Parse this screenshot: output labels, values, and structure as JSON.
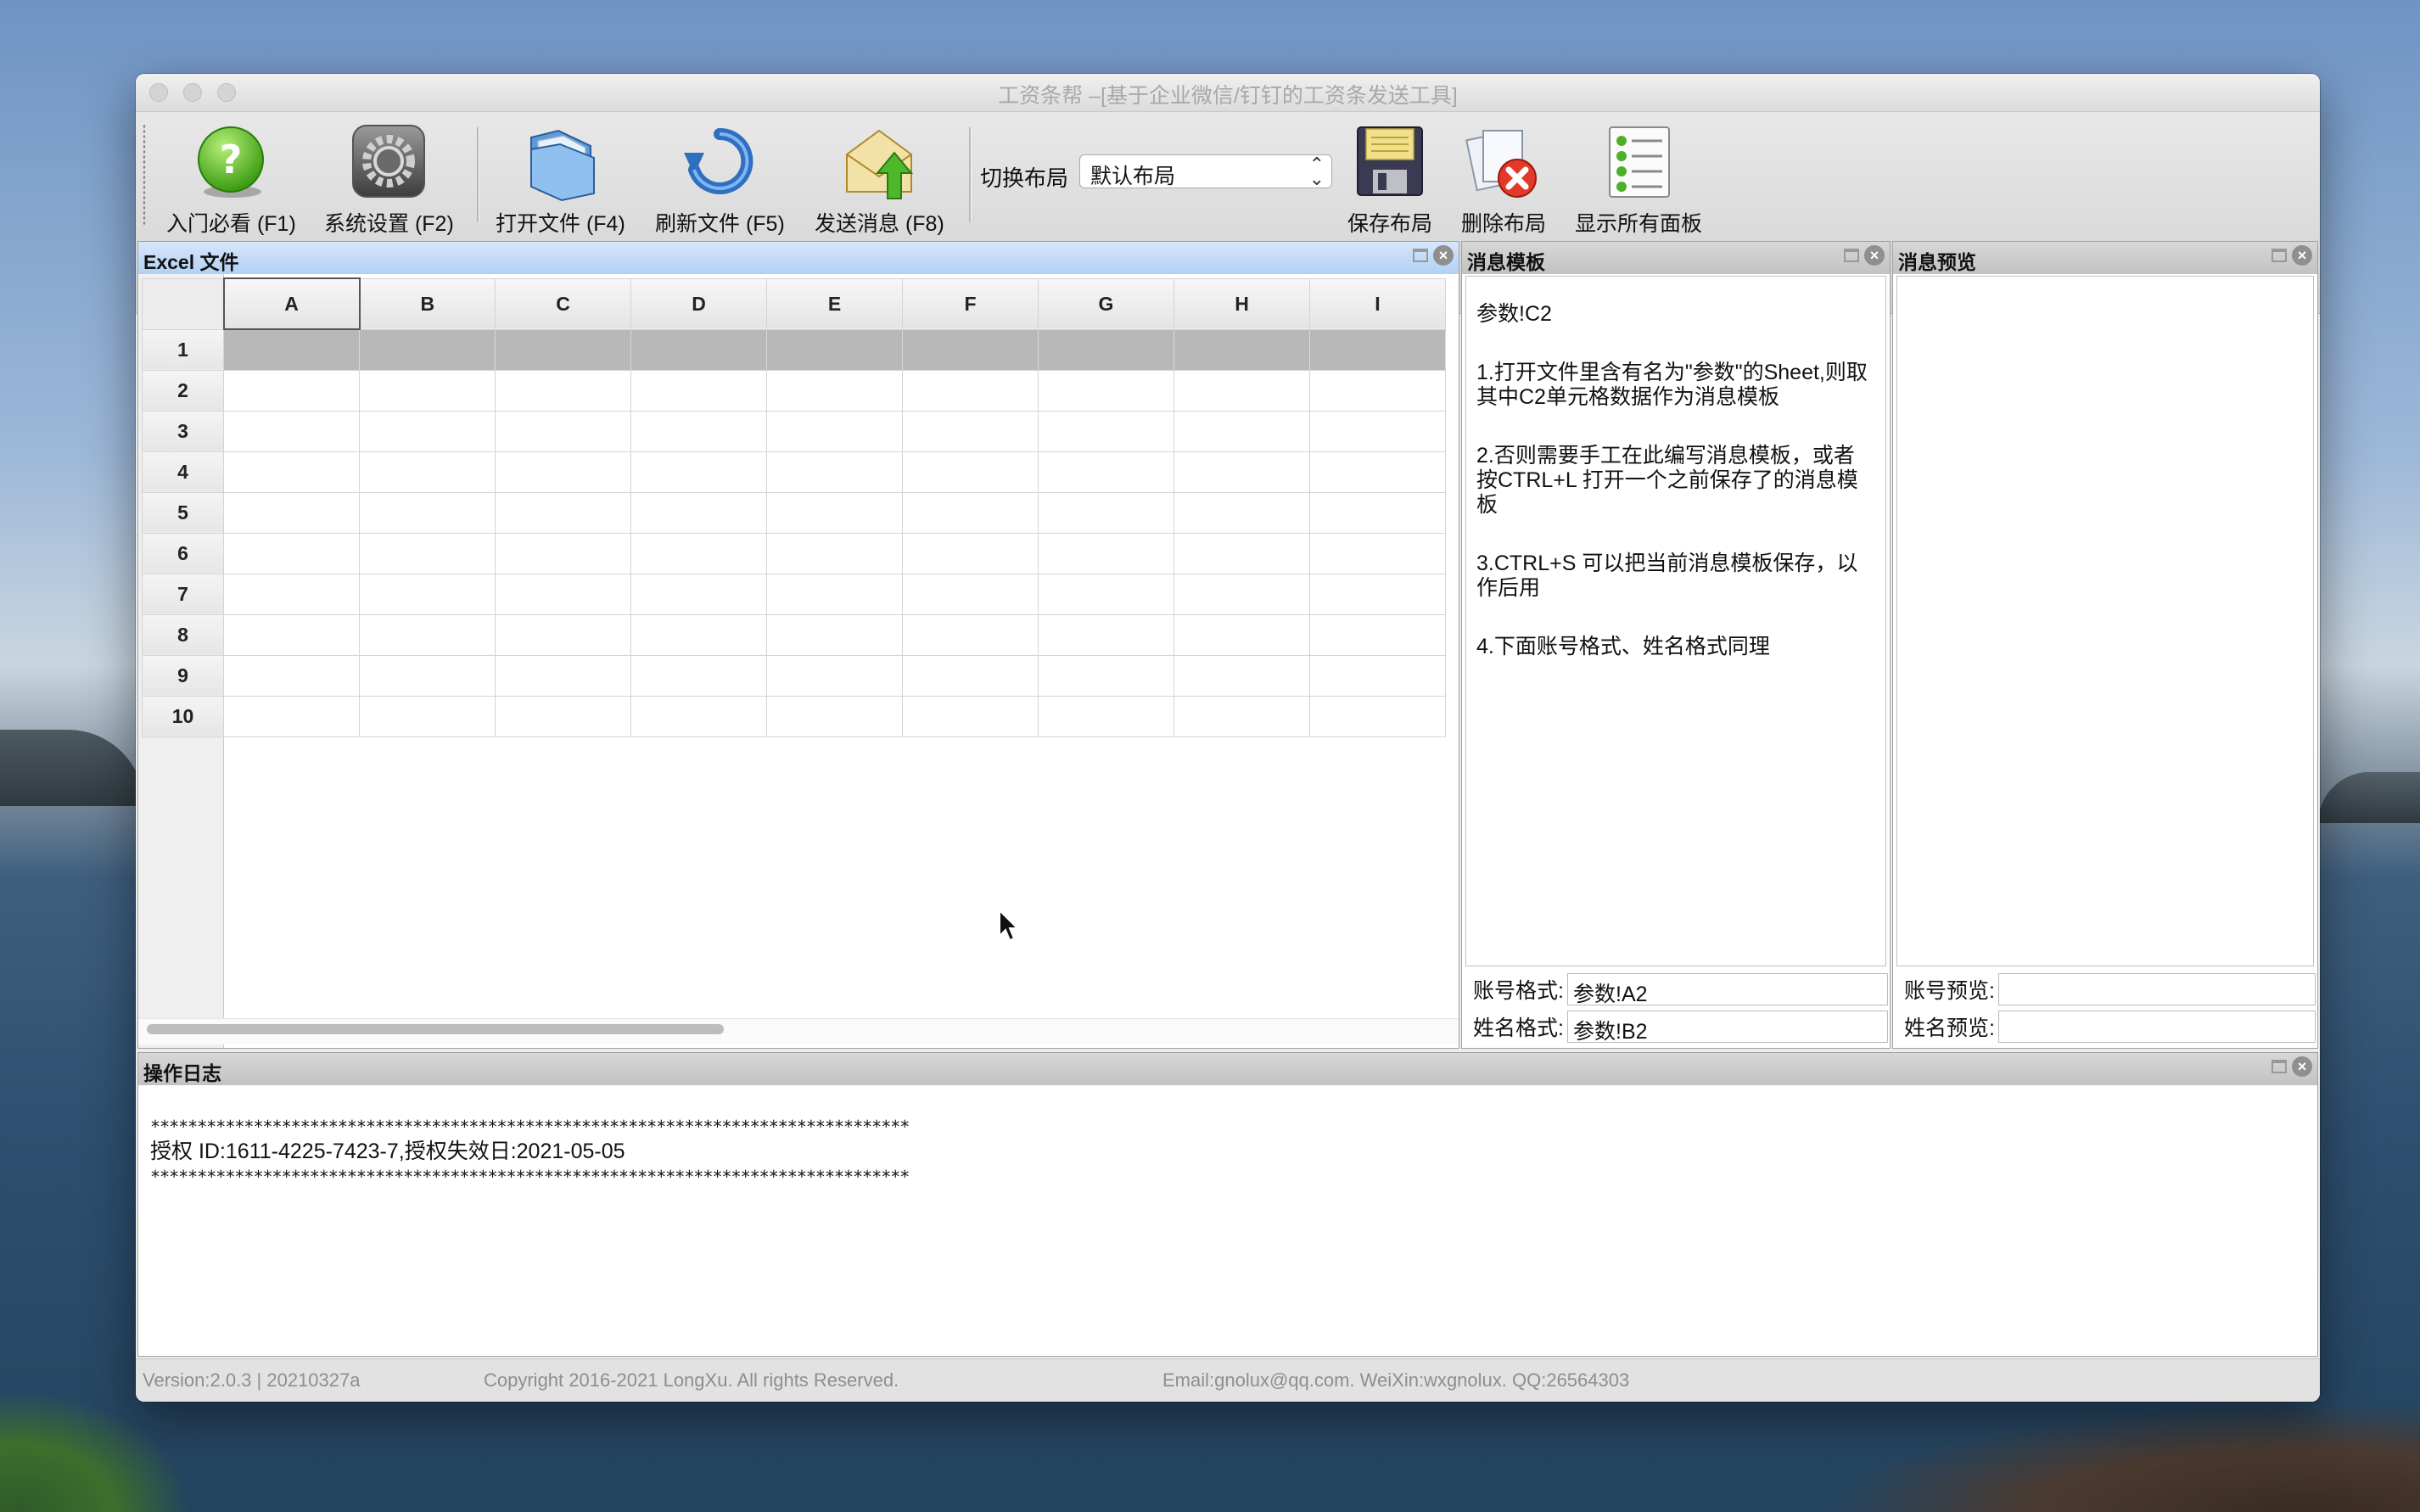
{
  "window": {
    "title": "工资条帮 –[基于企业微信/钉钉的工资条发送工具]"
  },
  "toolbar": {
    "help": "入门必看 (F1)",
    "settings": "系统设置 (F2)",
    "open_file": "打开文件 (F4)",
    "refresh_file": "刷新文件 (F5)",
    "send_message": "发送消息 (F8)",
    "switch_layout_label": "切换布局",
    "layout_value": "默认布局",
    "save_layout": "保存布局",
    "delete_layout": "删除布局",
    "show_all_panels": "显示所有面板"
  },
  "excel_panel": {
    "title": "Excel 文件",
    "columns": [
      "A",
      "B",
      "C",
      "D",
      "E",
      "F",
      "G",
      "H",
      "I"
    ],
    "rows": [
      "1",
      "2",
      "3",
      "4",
      "5",
      "6",
      "7",
      "8",
      "9",
      "10"
    ]
  },
  "template_panel": {
    "title": "消息模板",
    "lines": [
      "参数!C2",
      "1.打开文件里含有名为\"参数\"的Sheet,则取其中C2单元格数据作为消息模板",
      "2.否则需要手工在此编写消息模板，或者按CTRL+L 打开一个之前保存了的消息模板",
      "3.CTRL+S 可以把当前消息模板保存，以作后用",
      "4.下面账号格式、姓名格式同理"
    ],
    "account_format_label": "账号格式:",
    "account_format_value": "参数!A2",
    "name_format_label": "姓名格式:",
    "name_format_value": "参数!B2"
  },
  "preview_panel": {
    "title": "消息预览",
    "account_preview_label": "账号预览:",
    "account_preview_value": "",
    "name_preview_label": "姓名预览:",
    "name_preview_value": ""
  },
  "log_panel": {
    "title": "操作日志",
    "stars": "*********************************************************************************",
    "license": "授权 ID:1611-4225-7423-7,授权失效日:2021-05-05"
  },
  "statusbar": {
    "version": "Version:2.0.3 | 20210327a",
    "copyright": "Copyright 2016-2021 LongXu. All rights Reserved.",
    "contact": "Email:gnolux@qq.com.  WeiXin:wxgnolux. QQ:26564303"
  },
  "colors": {
    "accent_header": "#b2d0f4",
    "row_highlight": "#b8b8b8"
  }
}
